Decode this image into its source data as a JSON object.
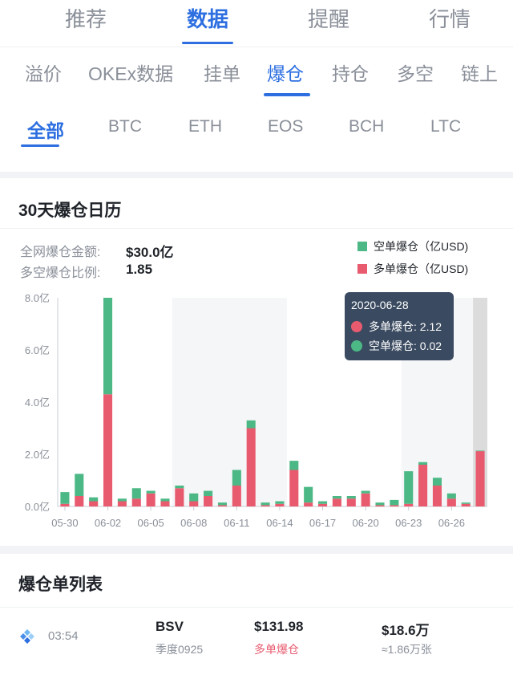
{
  "top_tabs": [
    "推荐",
    "数据",
    "提醒",
    "行情"
  ],
  "sub_tabs": [
    "溢价",
    "OKEx数据",
    "挂单",
    "爆仓",
    "持仓",
    "多空",
    "链上"
  ],
  "coin_tabs": [
    "全部",
    "BTC",
    "ETH",
    "EOS",
    "BCH",
    "LTC"
  ],
  "calendar": {
    "title": "30天爆仓日历",
    "total_label": "全网爆仓金额:",
    "total_value": "$30.0亿",
    "ratio_label": "多空爆仓比例:",
    "ratio_value": "1.85"
  },
  "legend": {
    "short_label": "空单爆仓（亿USD)",
    "long_label": "多单爆仓（亿USD)"
  },
  "colors": {
    "accent": "#2d6fe0",
    "short": "#4cb885",
    "long": "#e85b6f"
  },
  "chart_data": {
    "type": "bar",
    "stacked": true,
    "y_ticks": [
      "0.0亿",
      "2.0亿",
      "4.0亿",
      "6.0亿",
      "8.0亿"
    ],
    "ylim": [
      0,
      8
    ],
    "x_tick_labels": [
      "05-30",
      "06-02",
      "06-05",
      "06-08",
      "06-11",
      "06-14",
      "06-17",
      "06-20",
      "06-23",
      "06-26"
    ],
    "categories": [
      "05-30",
      "05-31",
      "06-01",
      "06-02",
      "06-03",
      "06-04",
      "06-05",
      "06-06",
      "06-07",
      "06-08",
      "06-09",
      "06-10",
      "06-11",
      "06-12",
      "06-13",
      "06-14",
      "06-15",
      "06-16",
      "06-17",
      "06-18",
      "06-19",
      "06-20",
      "06-21",
      "06-22",
      "06-23",
      "06-24",
      "06-25",
      "06-26",
      "06-27",
      "06-28"
    ],
    "series": [
      {
        "name": "多单爆仓（亿USD)",
        "values": [
          0.1,
          0.4,
          0.2,
          4.3,
          0.2,
          0.3,
          0.5,
          0.2,
          0.7,
          0.2,
          0.4,
          0.05,
          0.8,
          3.0,
          0.05,
          0.1,
          1.4,
          0.15,
          0.1,
          0.3,
          0.3,
          0.5,
          0.05,
          0.05,
          0.1,
          1.6,
          0.8,
          0.3,
          0.1,
          2.12
        ]
      },
      {
        "name": "空单爆仓（亿USD)",
        "values": [
          0.45,
          0.85,
          0.15,
          3.7,
          0.1,
          0.4,
          0.1,
          0.1,
          0.1,
          0.3,
          0.2,
          0.1,
          0.6,
          0.3,
          0.1,
          0.1,
          0.35,
          0.6,
          0.1,
          0.1,
          0.1,
          0.1,
          0.1,
          0.2,
          1.25,
          0.1,
          0.3,
          0.2,
          0.05,
          0.02
        ]
      }
    ],
    "tooltip": {
      "date": "2020-06-28",
      "long_text": "多单爆仓: 2.12",
      "short_text": "空单爆仓: 0.02"
    }
  },
  "list": {
    "title": "爆仓单列表",
    "rows": [
      {
        "time": "03:54",
        "symbol": "BSV",
        "contract": "季度0925",
        "price": "$131.98",
        "side": "多单爆仓",
        "amount": "$18.6万",
        "qty": "≈1.86万张"
      }
    ]
  }
}
